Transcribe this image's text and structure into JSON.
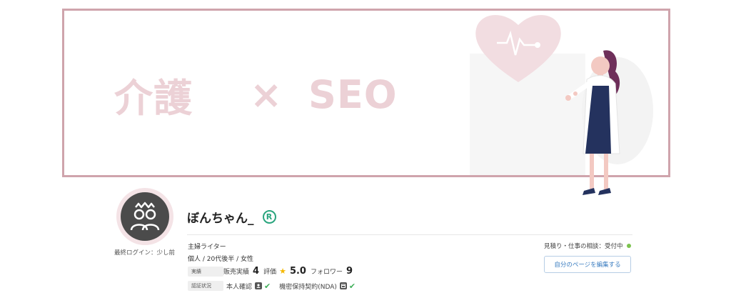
{
  "banner": {
    "part1": "介護",
    "times": "×",
    "part2": "SEO"
  },
  "profile": {
    "name": "ぼんちゃん_",
    "badge": "R",
    "last_login": "最終ログイン：少し前",
    "profession": "主婦ライター",
    "attributes": "個人 / 20代後半 / 女性"
  },
  "performance": {
    "tag": "実績",
    "sales_label": "販売実績",
    "sales_value": "4",
    "rating_label": "評価",
    "rating_value": "5.0",
    "followers_label": "フォロワー",
    "followers_value": "9"
  },
  "verification": {
    "tag": "認証状況",
    "identity": "本人確認",
    "nda": "機密保持契約(NDA)"
  },
  "consult": {
    "text": "見積り・仕事の相談：受付中",
    "status_color": "#7cc34e"
  },
  "actions": {
    "edit_label": "自分のページを編集する"
  },
  "colors": {
    "accent_pink": "#cfa4ac",
    "check_green": "#41b05b",
    "registered_green": "#2aa57e",
    "link_blue": "#3b7dc0"
  }
}
